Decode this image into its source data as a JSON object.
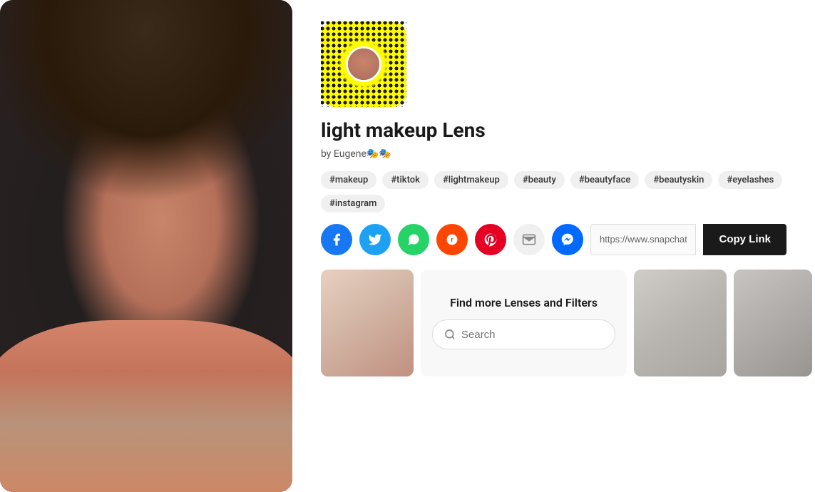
{
  "left": {
    "alt": "Woman with light makeup"
  },
  "lens": {
    "title": "light makeup Lens",
    "author": "by Eugene🎭🎭",
    "tags": [
      "#makeup",
      "#tiktok",
      "#lightmakeup",
      "#beauty",
      "#beautyface",
      "#beautyskin",
      "#eyelashes",
      "#instagram"
    ]
  },
  "share": {
    "link_url": "https://www.snapchat....",
    "copy_label": "Copy Link"
  },
  "discover": {
    "title": "Find more Lenses and Filters",
    "search_placeholder": "Search"
  },
  "social_buttons": [
    {
      "name": "facebook",
      "label": "f"
    },
    {
      "name": "twitter",
      "label": "t"
    },
    {
      "name": "whatsapp",
      "label": "w"
    },
    {
      "name": "reddit",
      "label": "r"
    },
    {
      "name": "pinterest",
      "label": "p"
    },
    {
      "name": "email",
      "label": "@"
    },
    {
      "name": "messenger",
      "label": "m"
    }
  ]
}
